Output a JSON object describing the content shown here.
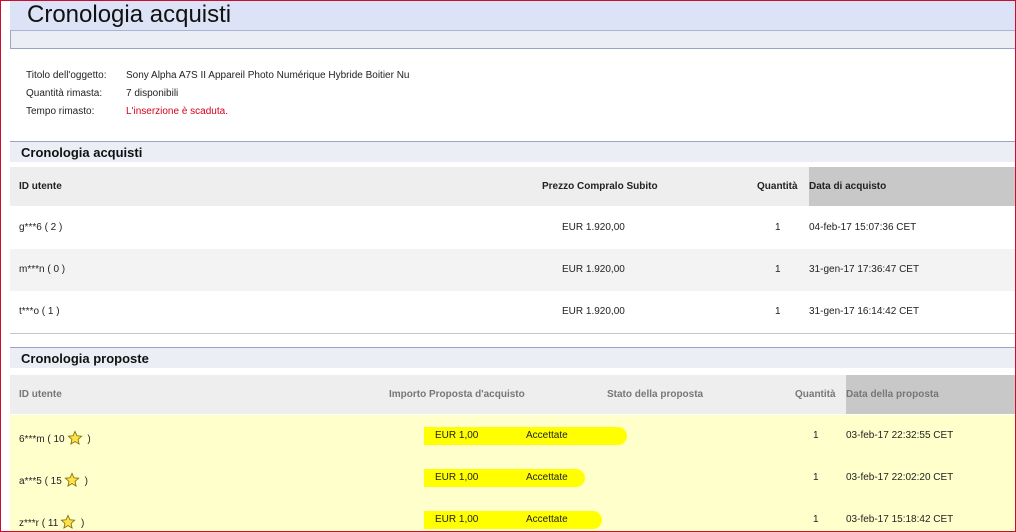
{
  "page": {
    "title": "Cronologia acquisti"
  },
  "item": {
    "title_label": "Titolo dell'oggetto:",
    "title_value": "Sony Alpha A7S II Appareil Photo Numérique Hybride Boitier Nu",
    "qty_label": "Quantità rimasta:",
    "qty_value": "7 disponibili",
    "time_label": "Tempo rimasto:",
    "time_value": "L'inserzione è scaduta."
  },
  "purchases": {
    "heading": "Cronologia acquisti",
    "headers": {
      "user": "ID utente",
      "price": "Prezzo Compralo Subito",
      "qty": "Quantità",
      "date": "Data di acquisto"
    },
    "rows": [
      {
        "user": "g***6 ( 2 )",
        "price": "EUR 1.920,00",
        "qty": "1",
        "date": "04-feb-17 15:07:36 CET"
      },
      {
        "user": "m***n ( 0 )",
        "price": "EUR 1.920,00",
        "qty": "1",
        "date": "31-gen-17 17:36:47 CET"
      },
      {
        "user": "t***o ( 1 )",
        "price": "EUR 1.920,00",
        "qty": "1",
        "date": "31-gen-17 16:14:42 CET"
      }
    ]
  },
  "offers": {
    "heading": "Cronologia proposte",
    "headers": {
      "user": "ID utente",
      "amount": "Importo Proposta d'acquisto",
      "status": "Stato della proposta",
      "qty": "Quantità",
      "date": "Data della proposta"
    },
    "rows": [
      {
        "user_prefix": "6***m  ( 10",
        "user_suffix": " )",
        "amount": "EUR 1,00",
        "status": "Accettate",
        "qty": "1",
        "date": "03-feb-17 22:32:55 CET"
      },
      {
        "user_prefix": "a***5  ( 15",
        "user_suffix": " )",
        "amount": "EUR 1,00",
        "status": "Accettate",
        "qty": "1",
        "date": "03-feb-17 22:02:20 CET"
      },
      {
        "user_prefix": "z***r  ( 11",
        "user_suffix": " )",
        "amount": "EUR 1,00",
        "status": "Accettate",
        "qty": "1",
        "date": "03-feb-17 15:18:42 CET"
      }
    ],
    "star_icon": "yellow-star-icon",
    "highlight_color": "#ffff00",
    "row_background": "#ffffcc"
  }
}
